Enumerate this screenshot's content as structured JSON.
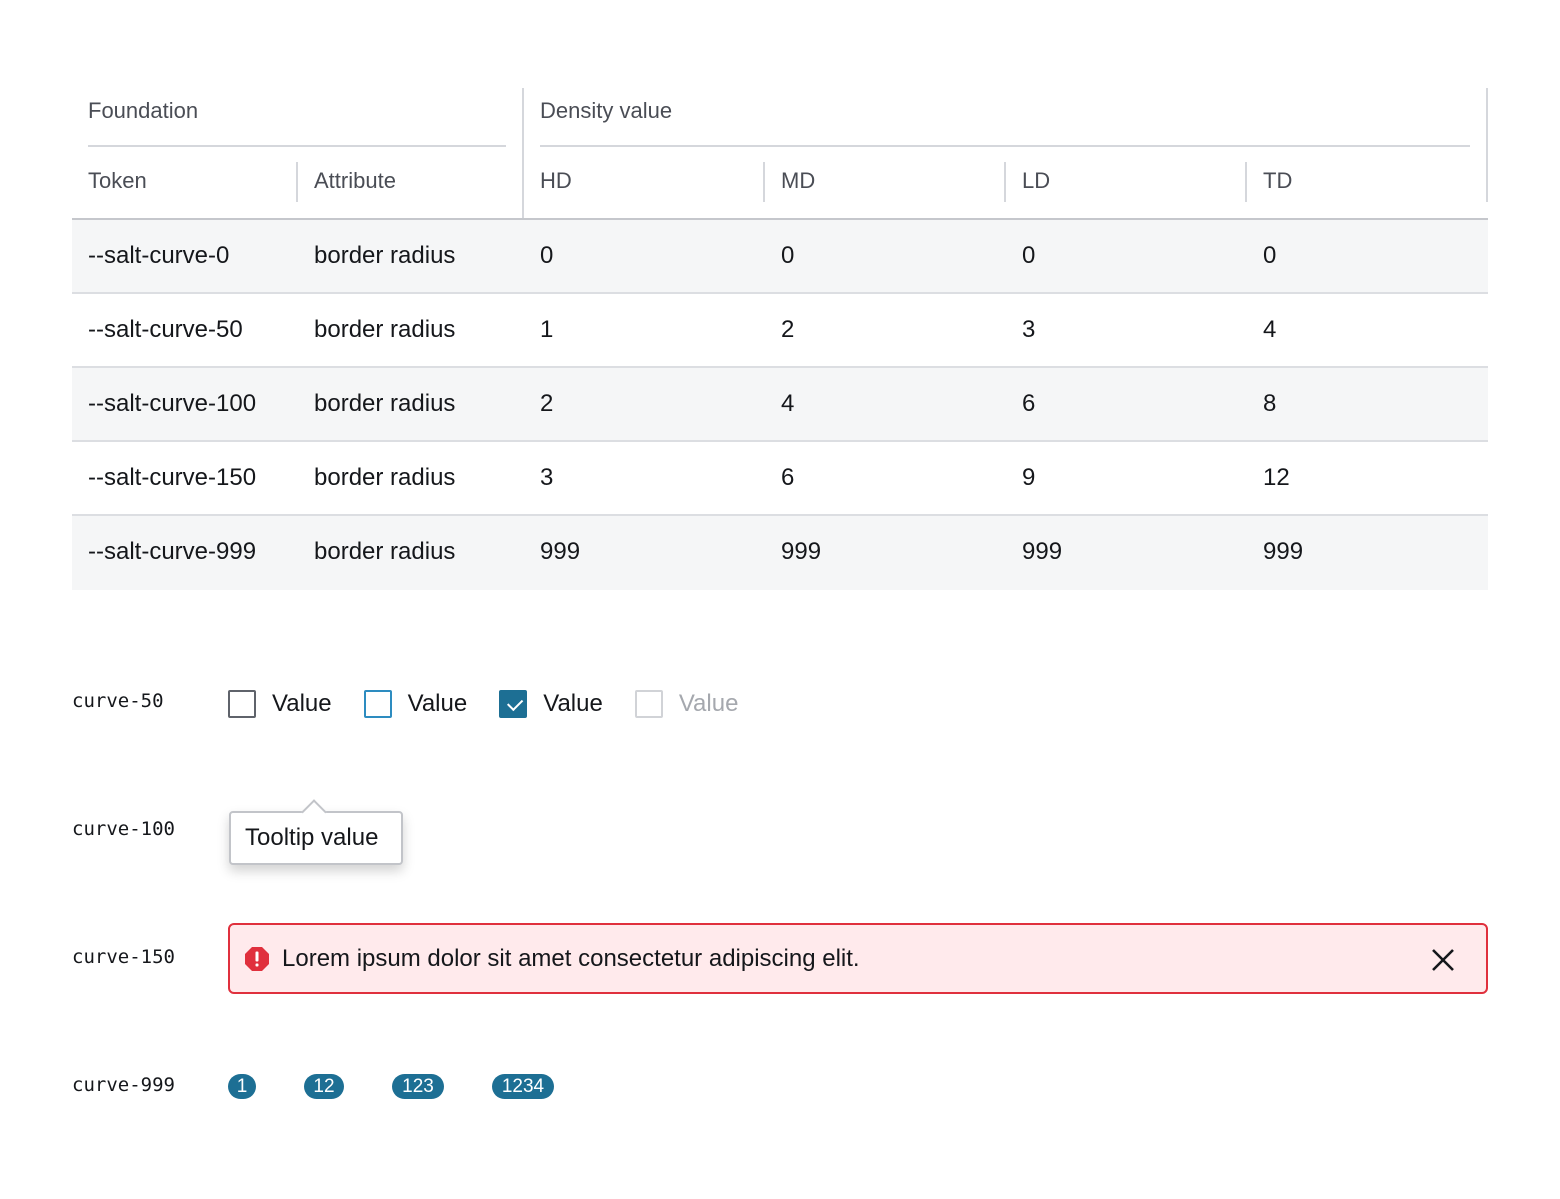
{
  "table": {
    "group_headers": {
      "foundation": "Foundation",
      "density": "Density value"
    },
    "columns": [
      "Token",
      "Attribute",
      "HD",
      "MD",
      "LD",
      "TD"
    ],
    "rows": [
      [
        "--salt-curve-0",
        "border radius",
        "0",
        "0",
        "0",
        "0"
      ],
      [
        "--salt-curve-50",
        "border radius",
        "1",
        "2",
        "3",
        "4"
      ],
      [
        "--salt-curve-100",
        "border radius",
        "2",
        "4",
        "6",
        "8"
      ],
      [
        "--salt-curve-150",
        "border radius",
        "3",
        "6",
        "9",
        "12"
      ],
      [
        "--salt-curve-999",
        "border radius",
        "999",
        "999",
        "999",
        "999"
      ]
    ]
  },
  "demos": {
    "checkbox": {
      "label": "curve-50",
      "items": [
        {
          "text": "Value",
          "state": "default"
        },
        {
          "text": "Value",
          "state": "hover"
        },
        {
          "text": "Value",
          "state": "checked"
        },
        {
          "text": "Value",
          "state": "disabled"
        }
      ]
    },
    "tooltip": {
      "label": "curve-100",
      "text": "Tooltip value"
    },
    "banner": {
      "label": "curve-150",
      "text": "Lorem ipsum dolor sit amet consectetur adipiscing elit.",
      "icon": "error-icon",
      "close_icon": "close-icon"
    },
    "badges": {
      "label": "curve-999",
      "values": [
        "1",
        "12",
        "123",
        "1234"
      ]
    }
  },
  "colors": {
    "accent": "#1d6f94",
    "error_border": "#e0303d",
    "error_background": "#ffeaec",
    "row_shade": "#f5f6f7"
  }
}
